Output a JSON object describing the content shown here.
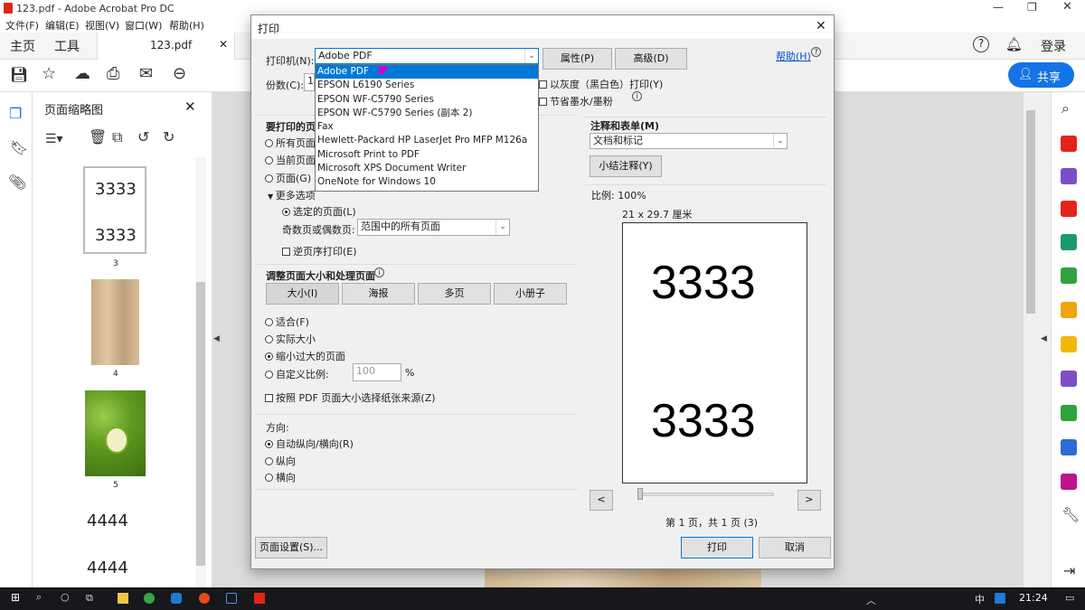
{
  "app": {
    "title": "123.pdf - Adobe Acrobat Pro DC",
    "menu": [
      "文件(F)",
      "编辑(E)",
      "视图(V)",
      "窗口(W)",
      "帮助(H)"
    ],
    "home_tab": "主页",
    "tools_tab": "工具",
    "doc_tab": "123.pdf",
    "signin": "登录",
    "share": "共享"
  },
  "thumbs": {
    "title": "页面缩略图",
    "pages": [
      {
        "text_top": "3333",
        "text_bottom": "3333",
        "num": "3"
      },
      {
        "num": "4"
      },
      {
        "num": "5"
      },
      {
        "text_top": "4444",
        "text_bottom": "4444"
      }
    ]
  },
  "dialog": {
    "title": "打印",
    "printer_label": "打印机(N):",
    "printer_value": "Adobe PDF",
    "printer_options": [
      "Adobe PDF",
      "EPSON L6190 Series",
      "EPSON WF-C5790 Series",
      "EPSON WF-C5790 Series (副本 2)",
      "Fax",
      "Hewlett-Packard HP LaserJet Pro MFP M126a",
      "Microsoft Print to PDF",
      "Microsoft XPS Document Writer",
      "OneNote for Windows 10"
    ],
    "properties_btn": "属性(P)",
    "advanced_btn": "高级(D)",
    "help_link": "帮助(H)",
    "copies_label": "份数(C):",
    "copies_value": "1",
    "grayscale": "以灰度（黑白色）打印(Y)",
    "save_ink": "节省墨水/墨粉",
    "pages_section": "要打印的页",
    "pages_all": "所有页面",
    "pages_current": "当前页面",
    "pages_range": "页面(G)",
    "more_options": "更多选项",
    "selected_pages": "选定的页面(L)",
    "odd_even_label": "奇数页或偶数页:",
    "odd_even_value": "范围中的所有页面",
    "reverse": "逆页序打印(E)",
    "sizing_section": "调整页面大小和处理页面",
    "size_btn": "大小(I)",
    "poster_btn": "海报",
    "multiple_btn": "多页",
    "booklet_btn": "小册子",
    "fit": "适合(F)",
    "actual_size": "实际大小",
    "shrink": "缩小过大的页面",
    "custom_scale": "自定义比例:",
    "custom_scale_value": "100",
    "percent": "%",
    "paper_source": "按照 PDF 页面大小选择纸张来源(Z)",
    "orientation_label": "方向:",
    "auto_orient": "自动纵向/横向(R)",
    "portrait": "纵向",
    "landscape": "横向",
    "comments_section": "注释和表单(M)",
    "comments_value": "文档和标记",
    "summarize_btn": "小结注释(Y)",
    "scale_text": "比例: 100%",
    "paper_size": "21 x 29.7 厘米",
    "preview_top": "3333",
    "preview_bottom": "3333",
    "prev_btn": "<",
    "next_btn": ">",
    "page_status": "第 1 页，共 1 页 (3)",
    "page_setup_btn": "页面设置(S)...",
    "print_btn": "打印",
    "cancel_btn": "取消"
  },
  "taskbar": {
    "time": "21:24",
    "ime": "中"
  },
  "colors": {
    "accent": "#0078d7",
    "share_bg": "#1473e6",
    "acrobat_red": "#e1251b"
  }
}
